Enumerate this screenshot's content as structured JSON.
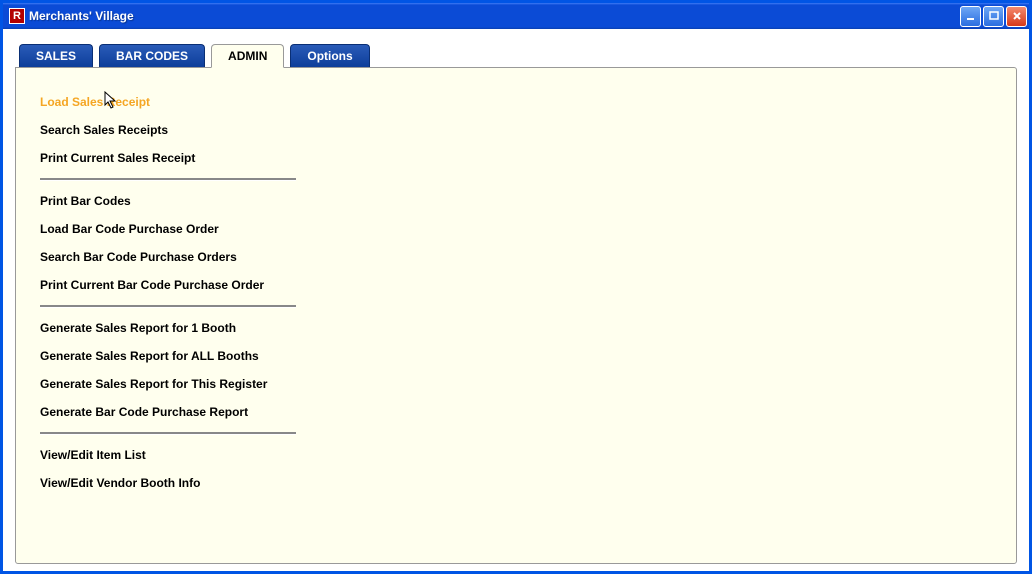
{
  "window": {
    "title": "Merchants' Village",
    "icon_letter": "R"
  },
  "tabs": [
    {
      "label": "SALES",
      "active": false
    },
    {
      "label": "BAR CODES",
      "active": false
    },
    {
      "label": "ADMIN",
      "active": true
    },
    {
      "label": "Options",
      "active": false
    }
  ],
  "menu": {
    "groups": [
      [
        {
          "label": "Load Sales Receipt",
          "highlighted": true
        },
        {
          "label": "Search Sales Receipts",
          "highlighted": false
        },
        {
          "label": "Print Current Sales Receipt",
          "highlighted": false
        }
      ],
      [
        {
          "label": "Print Bar Codes",
          "highlighted": false
        },
        {
          "label": "Load Bar Code Purchase Order",
          "highlighted": false
        },
        {
          "label": "Search Bar Code Purchase Orders",
          "highlighted": false
        },
        {
          "label": "Print Current Bar Code Purchase Order",
          "highlighted": false
        }
      ],
      [
        {
          "label": "Generate Sales Report for 1 Booth",
          "highlighted": false
        },
        {
          "label": "Generate Sales Report for ALL Booths",
          "highlighted": false
        },
        {
          "label": "Generate Sales Report for This Register",
          "highlighted": false
        },
        {
          "label": "Generate Bar Code Purchase Report",
          "highlighted": false
        }
      ],
      [
        {
          "label": "View/Edit Item List",
          "highlighted": false
        },
        {
          "label": "View/Edit Vendor Booth Info",
          "highlighted": false
        }
      ]
    ]
  }
}
